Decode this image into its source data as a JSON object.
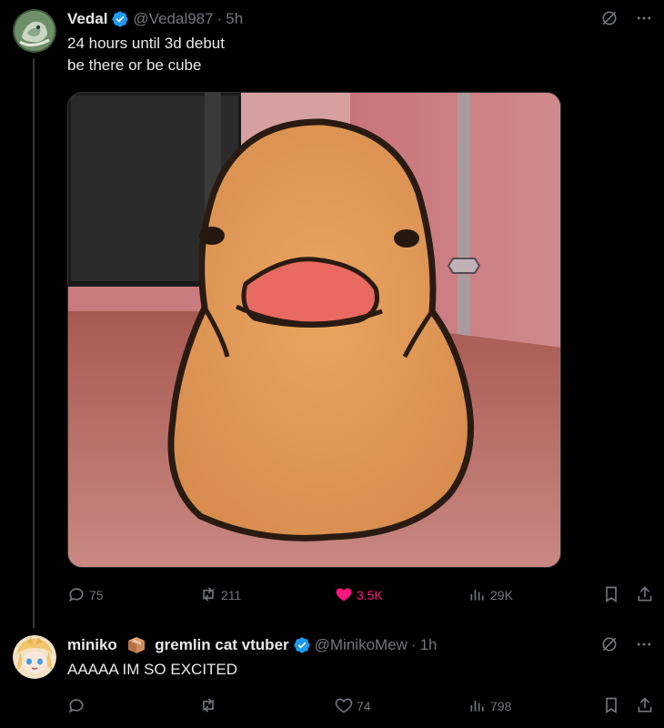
{
  "tweets": [
    {
      "display_name": "Vedal",
      "handle": "@Vedal987",
      "separator": "·",
      "time": "5h",
      "lines": [
        "24 hours until 3d debut",
        "be there or be cube"
      ],
      "replies": "75",
      "reposts": "211",
      "likes": "3.5K",
      "views": "29K",
      "liked": true
    },
    {
      "display_name_before_emoji": "miniko",
      "display_name_after_emoji": "gremlin cat vtuber",
      "handle": "@MinikoMew",
      "separator": "·",
      "time": "1h",
      "lines": [
        "AAAAA IM SO EXCITED"
      ],
      "replies": "",
      "reposts": "",
      "likes": "74",
      "views": "798",
      "liked": false
    }
  ],
  "colors": {
    "background": "#000000",
    "text": "#e7e9ea",
    "muted": "#71767b",
    "verified": "#1d9bf0",
    "like": "#f91880"
  },
  "icons": {
    "verified": "verified-badge-icon",
    "grok": "grok-icon",
    "more": "more-icon",
    "reply": "reply-icon",
    "repost": "repost-icon",
    "like": "heart-icon",
    "views": "views-icon",
    "bookmark": "bookmark-icon",
    "share": "share-icon"
  }
}
